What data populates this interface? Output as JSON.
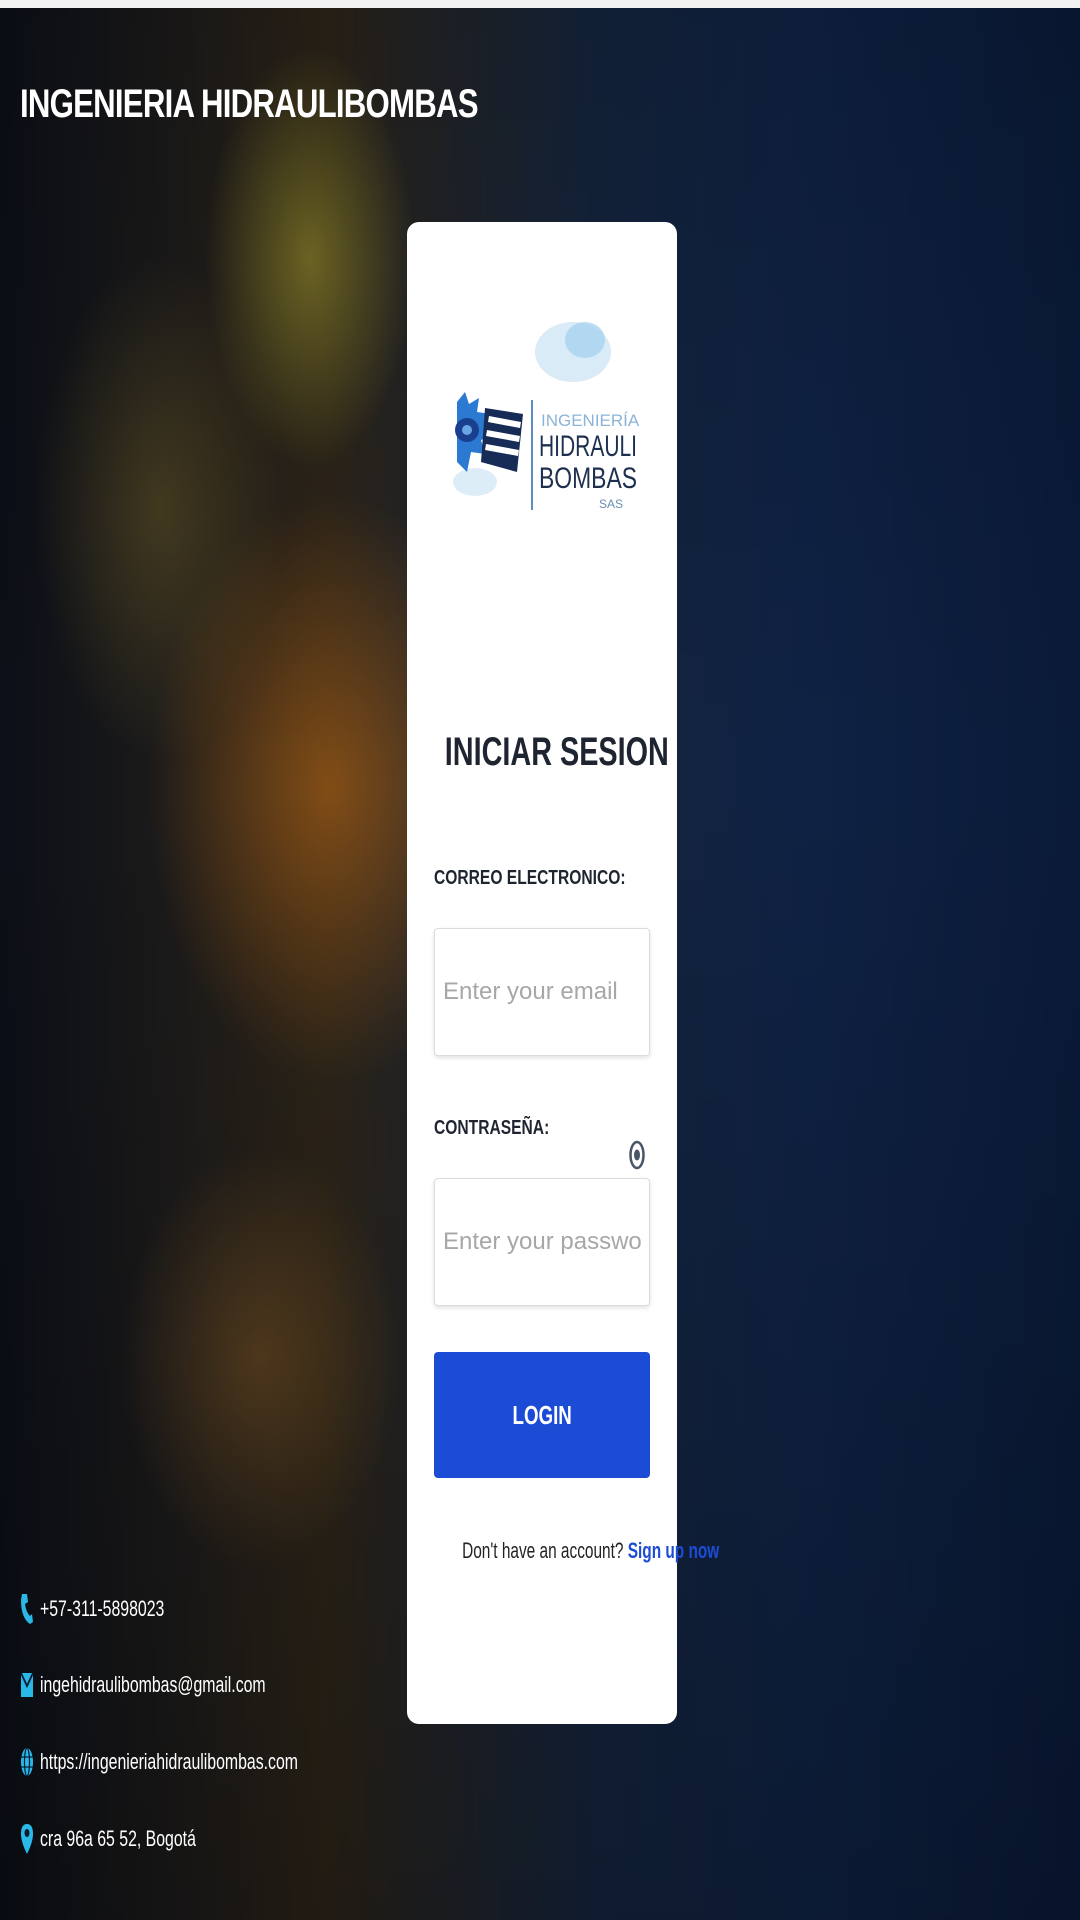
{
  "header": {
    "brand": "INGENIERIA HIDRAULIBOMBAS"
  },
  "logo": {
    "line1": "INGENIERÍA",
    "line2": "HIDRAULI",
    "line3": "BOMBAS",
    "line4": "SAS"
  },
  "form": {
    "title": "INICIAR SESION",
    "email_label": "CORREO ELECTRONICO:",
    "email_placeholder": "Enter your email",
    "email_value": "",
    "password_label": "CONTRASEÑA:",
    "password_placeholder": "Enter your password",
    "password_value": "",
    "login_label": "LOGIN",
    "signup_prompt": "Don't have an account?",
    "signup_link": "Sign up now"
  },
  "contact": {
    "phone": "+57-311-5898023",
    "email": "ingehidraulibombas@gmail.com",
    "website": "https://ingenieriahidraulibombas.com",
    "address": "cra 96a 65 52, Bogotá"
  },
  "colors": {
    "accent": "#1c4bd6",
    "contact_icon": "#2ab8e6",
    "card_bg": "#ffffff"
  },
  "icons": {
    "phone": "phone-icon",
    "mail": "mail-icon",
    "web": "globe-icon",
    "address": "location-pin-icon",
    "password_toggle": "eye-icon"
  }
}
